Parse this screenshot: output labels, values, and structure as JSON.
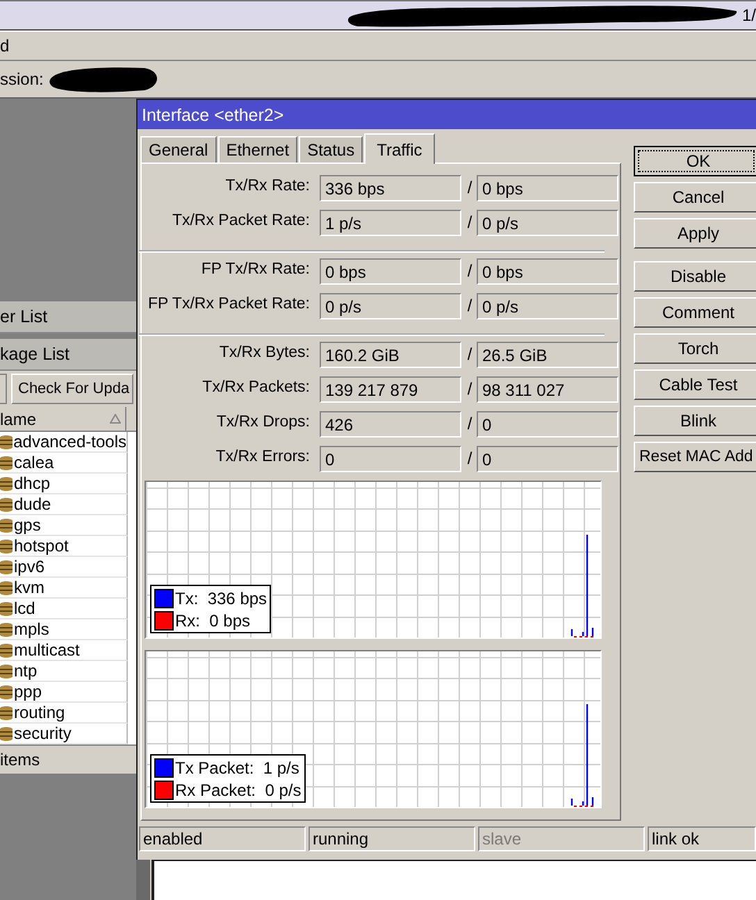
{
  "title_bar": {
    "text": "1/"
  },
  "menu_bar": {
    "text": "d"
  },
  "session_bar": {
    "label": "ssion:"
  },
  "back_window": {
    "title": "er List"
  },
  "package_list": {
    "title": "kage List",
    "toolbar_button": "Check For Upda",
    "column_1": "lame",
    "rows": [
      "advanced-tools",
      "calea",
      "dhcp",
      "dude",
      "gps",
      "hotspot",
      "ipv6",
      "kvm",
      "lcd",
      "mpls",
      "multicast",
      "ntp",
      "ppp",
      "routing",
      "security"
    ],
    "status": "items"
  },
  "dialog": {
    "title": "Interface <ether2>",
    "tabs": [
      {
        "label": "General",
        "selected": false
      },
      {
        "label": "Ethernet",
        "selected": false
      },
      {
        "label": "Status",
        "selected": false
      },
      {
        "label": "Traffic",
        "selected": true
      }
    ],
    "field_groups": [
      [
        {
          "label": "Tx/Rx Rate:",
          "tx": "336 bps",
          "rx": "0 bps"
        },
        {
          "label": "Tx/Rx Packet Rate:",
          "tx": "1 p/s",
          "rx": "0 p/s"
        }
      ],
      [
        {
          "label": "FP Tx/Rx Rate:",
          "tx": "0 bps",
          "rx": "0 bps"
        },
        {
          "label": "FP Tx/Rx Packet Rate:",
          "tx": "0 p/s",
          "rx": "0 p/s"
        }
      ],
      [
        {
          "label": "Tx/Rx Bytes:",
          "tx": "160.2 GiB",
          "rx": "26.5 GiB"
        },
        {
          "label": "Tx/Rx Packets:",
          "tx": "139 217 879",
          "rx": "98 311 027"
        },
        {
          "label": "Tx/Rx Drops:",
          "tx": "426",
          "rx": "0"
        },
        {
          "label": "Tx/Rx Errors:",
          "tx": "0",
          "rx": "0"
        }
      ]
    ],
    "separator": "/",
    "graphs": [
      {
        "legend": [
          {
            "label": "Tx:",
            "value": "336 bps",
            "color": "#0000ff"
          },
          {
            "label": "Rx:",
            "value": "0 bps",
            "color": "#ff0000"
          }
        ]
      },
      {
        "legend": [
          {
            "label": "Tx Packet:",
            "value": "1 p/s",
            "color": "#0000ff"
          },
          {
            "label": "Rx Packet:",
            "value": "0 p/s",
            "color": "#ff0000"
          }
        ]
      }
    ],
    "button_groups": [
      [
        {
          "label": "OK",
          "focused": true
        },
        {
          "label": "Cancel",
          "focused": false
        },
        {
          "label": "Apply",
          "focused": false
        }
      ],
      [
        {
          "label": "Disable",
          "focused": false
        },
        {
          "label": "Comment",
          "focused": false
        },
        {
          "label": "Torch",
          "focused": false
        },
        {
          "label": "Cable Test",
          "focused": false
        },
        {
          "label": "Blink",
          "focused": false
        },
        {
          "label": "Reset MAC Add",
          "focused": false
        }
      ]
    ],
    "status_bar": [
      {
        "text": "enabled",
        "disabled": false
      },
      {
        "text": "running",
        "disabled": false
      },
      {
        "text": "slave",
        "disabled": true
      },
      {
        "text": "link ok",
        "disabled": false
      }
    ]
  }
}
